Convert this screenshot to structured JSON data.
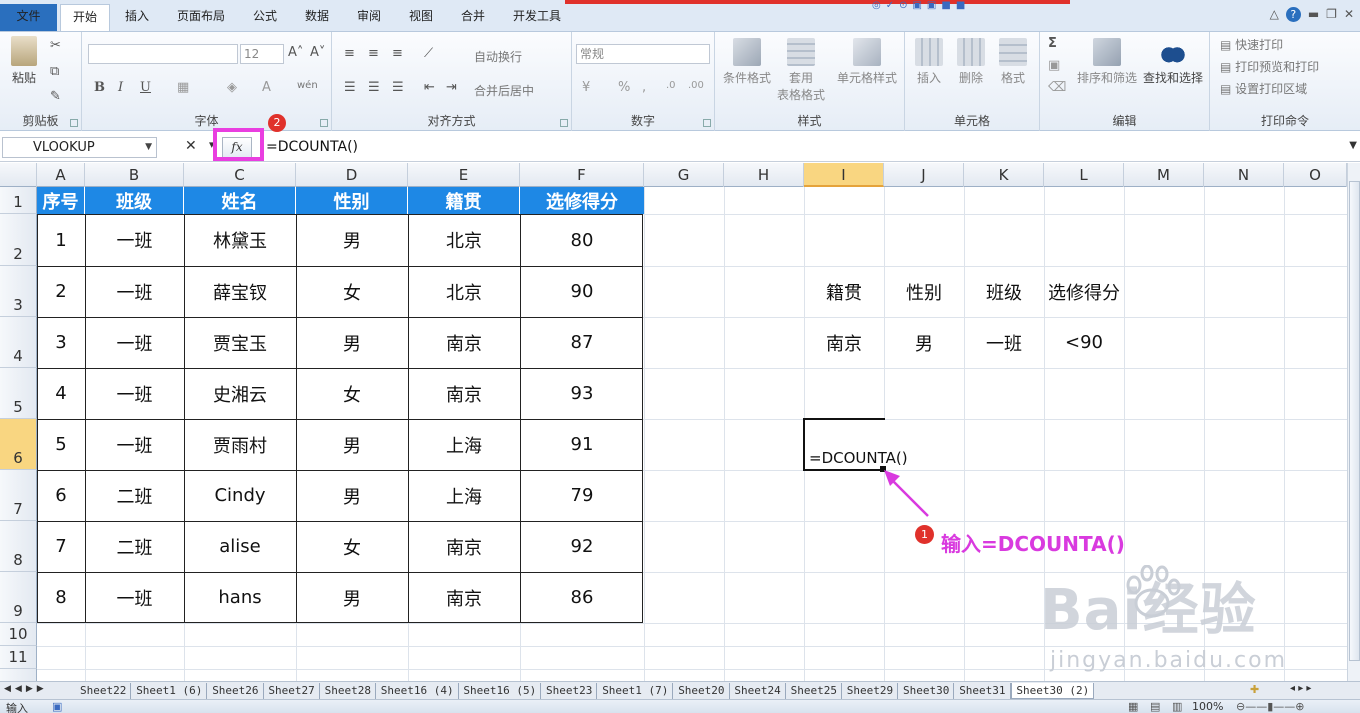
{
  "tabs": [
    "文件",
    "开始",
    "插入",
    "页面布局",
    "公式",
    "数据",
    "审阅",
    "视图",
    "合并",
    "开发工具"
  ],
  "ribbon": {
    "clipboard": {
      "label": "剪贴板",
      "paste": "粘贴"
    },
    "font": {
      "label": "字体",
      "size": "12",
      "wen": "wén"
    },
    "align": {
      "label": "对齐方式",
      "wrap": "自动换行",
      "merge": "合并后居中"
    },
    "number": {
      "label": "数字",
      "format": "常规"
    },
    "styles": {
      "label": "样式",
      "cond": "条件格式",
      "table1": "套用",
      "table2": "表格格式",
      "cell": "单元格样式"
    },
    "cells": {
      "label": "单元格",
      "insert": "插入",
      "delete": "删除",
      "format": "格式"
    },
    "edit": {
      "label": "编辑",
      "sort": "排序和筛选",
      "find": "查找和选择"
    },
    "print": {
      "label": "打印命令",
      "quick": "快速打印",
      "preview": "打印预览和打印",
      "area": "设置打印区域"
    }
  },
  "formula_bar": {
    "name_box": "VLOOKUP",
    "fx": "fx",
    "formula": "=DCOUNTA()"
  },
  "columns": [
    "A",
    "B",
    "C",
    "D",
    "E",
    "F",
    "G",
    "H",
    "I",
    "J",
    "K",
    "L",
    "M",
    "N",
    "O"
  ],
  "rows": [
    "1",
    "2",
    "3",
    "4",
    "5",
    "6",
    "7",
    "8",
    "9",
    "10",
    "11"
  ],
  "table": {
    "headers": [
      "序号",
      "班级",
      "姓名",
      "性别",
      "籍贯",
      "选修得分"
    ],
    "rows": [
      [
        "1",
        "一班",
        "林黛玉",
        "男",
        "北京",
        "80"
      ],
      [
        "2",
        "一班",
        "薛宝钗",
        "女",
        "北京",
        "90"
      ],
      [
        "3",
        "一班",
        "贾宝玉",
        "男",
        "南京",
        "87"
      ],
      [
        "4",
        "一班",
        "史湘云",
        "女",
        "南京",
        "93"
      ],
      [
        "5",
        "一班",
        "贾雨村",
        "男",
        "上海",
        "91"
      ],
      [
        "6",
        "二班",
        "Cindy",
        "男",
        "上海",
        "79"
      ],
      [
        "7",
        "二班",
        "alise",
        "女",
        "南京",
        "92"
      ],
      [
        "8",
        "一班",
        "hans",
        "男",
        "南京",
        "86"
      ]
    ]
  },
  "criteria": {
    "headers": [
      "籍贯",
      "性别",
      "班级",
      "选修得分"
    ],
    "values": [
      "南京",
      "男",
      "一班",
      "<90"
    ]
  },
  "active_cell": {
    "text": "=DCOUNTA()"
  },
  "annotations": {
    "badge1": "1",
    "badge2": "2",
    "note1": "输入=DCOUNTA()"
  },
  "watermark": {
    "main": "Bai经验",
    "sub": "jingyan.baidu.com"
  },
  "sheets": [
    "Sheet22",
    "Sheet1 (6)",
    "Sheet26",
    "Sheet27",
    "Sheet28",
    "Sheet16 (4)",
    "Sheet16 (5)",
    "Sheet23",
    "Sheet1 (7)",
    "Sheet20",
    "Sheet24",
    "Sheet25",
    "Sheet29",
    "Sheet30",
    "Sheet31",
    "Sheet30 (2)"
  ],
  "status": {
    "mode": "输入",
    "zoom": "100%"
  },
  "colors": {
    "header_bg": "#1e88e5",
    "highlight": "#e93ee0",
    "badge": "#e0312b"
  }
}
